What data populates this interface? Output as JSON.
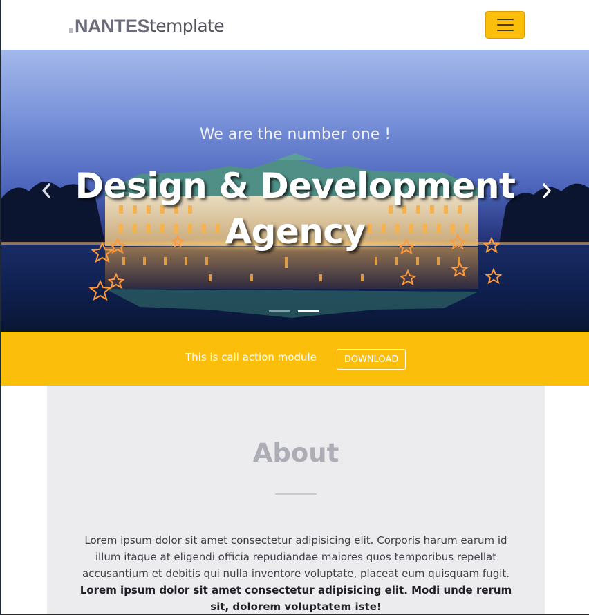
{
  "header": {
    "logo_bold": "NANTES",
    "logo_light": "template",
    "menu_icon": "hamburger-icon",
    "accent_color": "#fbbe0a"
  },
  "hero": {
    "subtitle": "We are the number one !",
    "title": "Design & Development Agency",
    "prev_icon": "chevron-left-icon",
    "next_icon": "chevron-right-icon",
    "slides_count": 2,
    "active_slide": 2
  },
  "cta": {
    "text": "This is call action module",
    "button_label": "DOWNLOAD"
  },
  "about": {
    "title": "About",
    "paragraph": "Lorem ipsum dolor sit amet consectetur adipisicing elit. Corporis harum earum id illum itaque at eligendi officia repudiandae maiores quos temporibus repellat accusantium et debitis qui nulla inventore voluptate, placeat eum quisquam fugit.",
    "paragraph_bold": "Lorem ipsum dolor sit amet consectetur adipisicing elit. Modi unde rerum sit, dolorem voluptatem iste!"
  }
}
